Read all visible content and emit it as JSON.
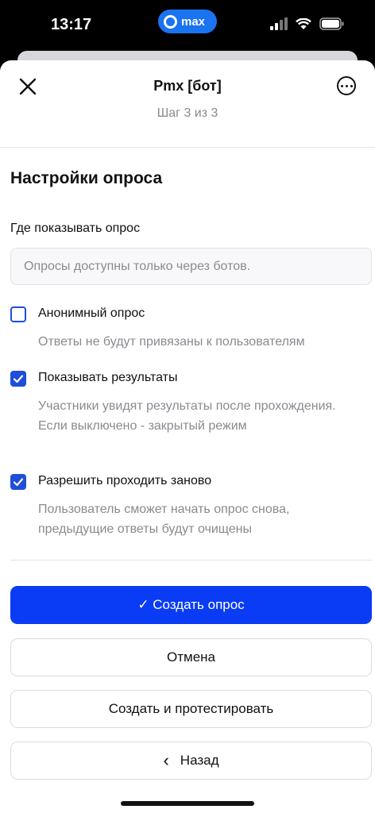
{
  "status": {
    "time": "13:17",
    "app_pill": "max"
  },
  "header": {
    "title": "Pmx [бот]",
    "subtitle": "Шаг 3 из 3"
  },
  "section": {
    "title": "Настройки опроса"
  },
  "display_field": {
    "label": "Где показывать опрос",
    "placeholder": "Опросы доступны только через ботов."
  },
  "options": [
    {
      "label": "Анонимный опрос",
      "description": "Ответы не будут привязаны к пользователям",
      "checked": false
    },
    {
      "label": "Показывать результаты",
      "description": "Участники увидят результаты после прохождения. Если выключено - закрытый режим",
      "checked": true
    },
    {
      "label": "Разрешить проходить заново",
      "description": "Пользователь сможет начать опрос снова, предыдущие ответы будут очищены",
      "checked": true
    }
  ],
  "buttons": {
    "create": "✓ Создать опрос",
    "cancel": "Отмена",
    "create_and_test": "Создать и протестировать",
    "back": "Назад",
    "back_icon": "‹"
  },
  "colors": {
    "accent": "#0a3cf5",
    "checkbox": "#1f4ed8",
    "pill": "#1a73f0"
  },
  "icons": [
    "close-icon",
    "more-icon",
    "checkbox-icon",
    "chevron-left-icon",
    "signal-icon",
    "wifi-icon",
    "battery-icon"
  ]
}
